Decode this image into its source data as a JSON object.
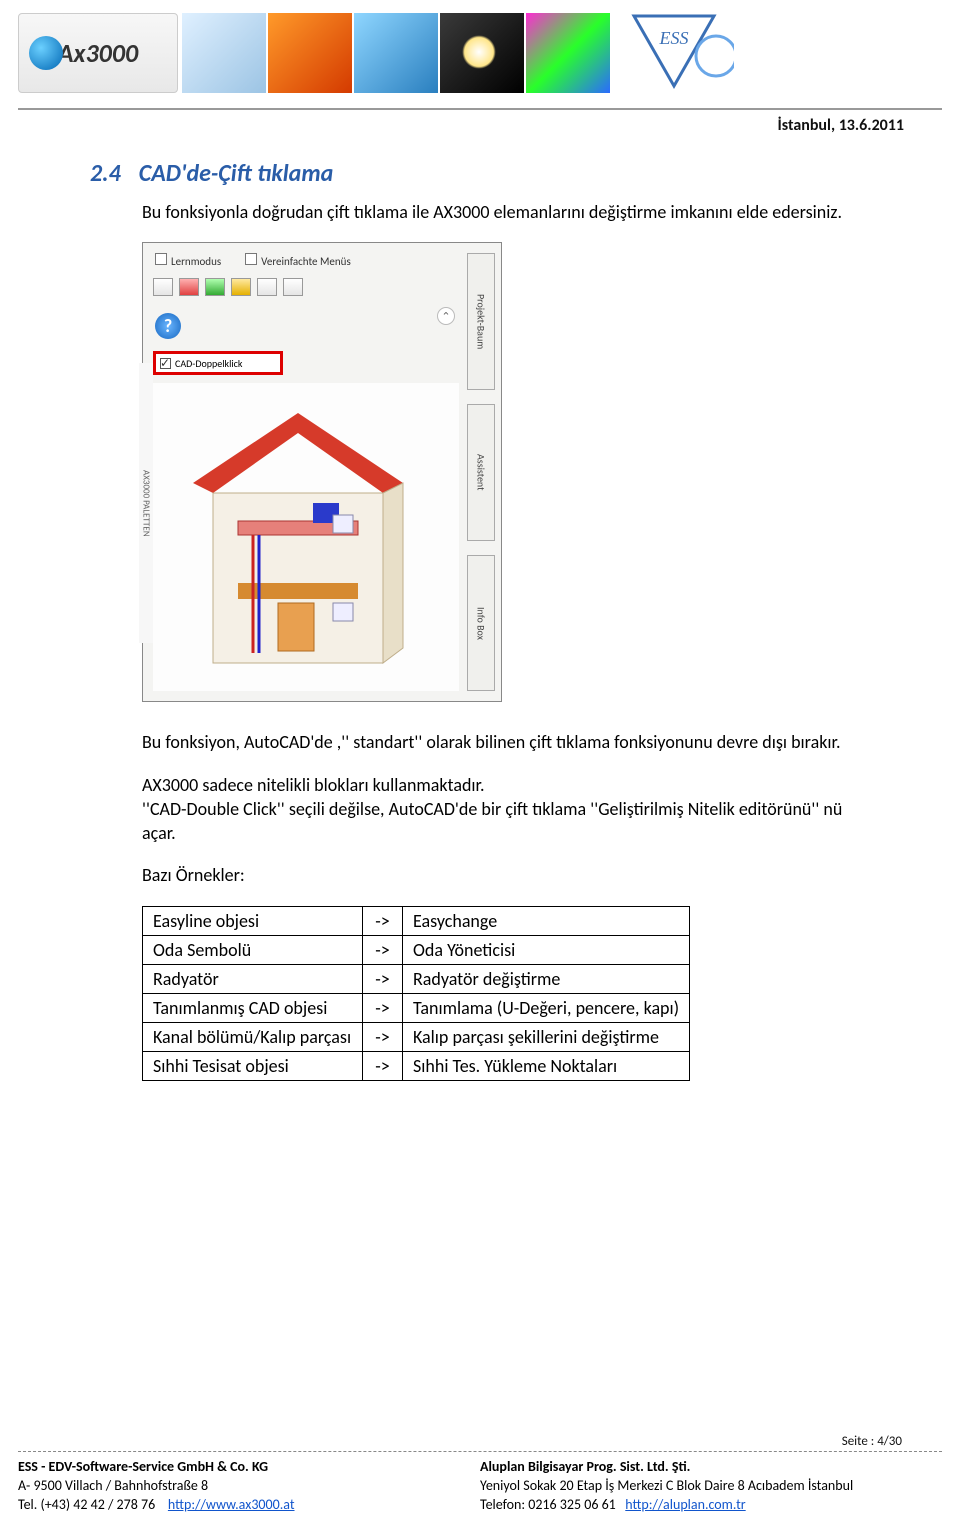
{
  "header": {
    "logo_text": "Ax3000",
    "date": "İstanbul, 13.6.2011"
  },
  "section": {
    "number": "2.4",
    "title": "CAD'de-Çift tıklama",
    "intro": "Bu fonksiyonla doğrudan çift tıklama ile  AX3000 elemanlarını değiştirme imkanını elde edersiniz.",
    "para2": "Bu fonksiyon, AutoCAD'de ,'' standart'' olarak bilinen çift tıklama fonksiyonunu devre dışı bırakır.",
    "para3a": "AX3000 sadece nitelikli blokları kullanmaktadır.",
    "para3b": "''CAD-Double Click'' seçili değilse, AutoCAD'de bir çift tıklama  ''Geliştirilmiş Nitelik editörünü'' nü açar.",
    "para4": "Bazı Örnekler:"
  },
  "screenshot": {
    "lernmodus": "Lernmodus",
    "vereinfachte": "Vereinfachte Menüs",
    "cad_doppelklick": "CAD-Doppelklick",
    "tab_projekt": "Projekt-Baum",
    "tab_assistent": "Assistent",
    "tab_infobox": "Info Box",
    "left_label": "AX3000 PALETTEN"
  },
  "table": {
    "arrow": "->",
    "rows": [
      {
        "l": "Easyline objesi",
        "r": "Easychange"
      },
      {
        "l": "Oda Sembolü",
        "r": "Oda Yöneticisi"
      },
      {
        "l": "Radyatör",
        "r": "Radyatör değiştirme"
      },
      {
        "l": "Tanımlanmış CAD objesi",
        "r": "Tanımlama (U-Değeri, pencere, kapı)"
      },
      {
        "l": "Kanal bölümü/Kalıp parçası",
        "r": "Kalıp parçası şekillerini değiştirme"
      },
      {
        "l": "Sıhhi Tesisat objesi",
        "r": "Sıhhi  Tes. Yükleme Noktaları"
      }
    ]
  },
  "footer": {
    "page": "Seite : 4/30",
    "left": {
      "l1": "ESS - EDV-Software-Service GmbH & Co. KG",
      "l2": "A- 9500 Villach / Bahnhofstraße 8",
      "l3_pre": "Tel. (+43) 42 42 / 278 76",
      "l3_link": "http://www.ax3000.at"
    },
    "right": {
      "l1": "Aluplan Bilgisayar Prog. Sist. Ltd. Şti.",
      "l2": "Yeniyol Sokak 20 Etap İş Merkezi C Blok Daire 8 Acıbadem İstanbul",
      "l3_pre": "Telefon: 0216 325 06 61",
      "l3_link": "http://aluplan.com.tr"
    }
  }
}
